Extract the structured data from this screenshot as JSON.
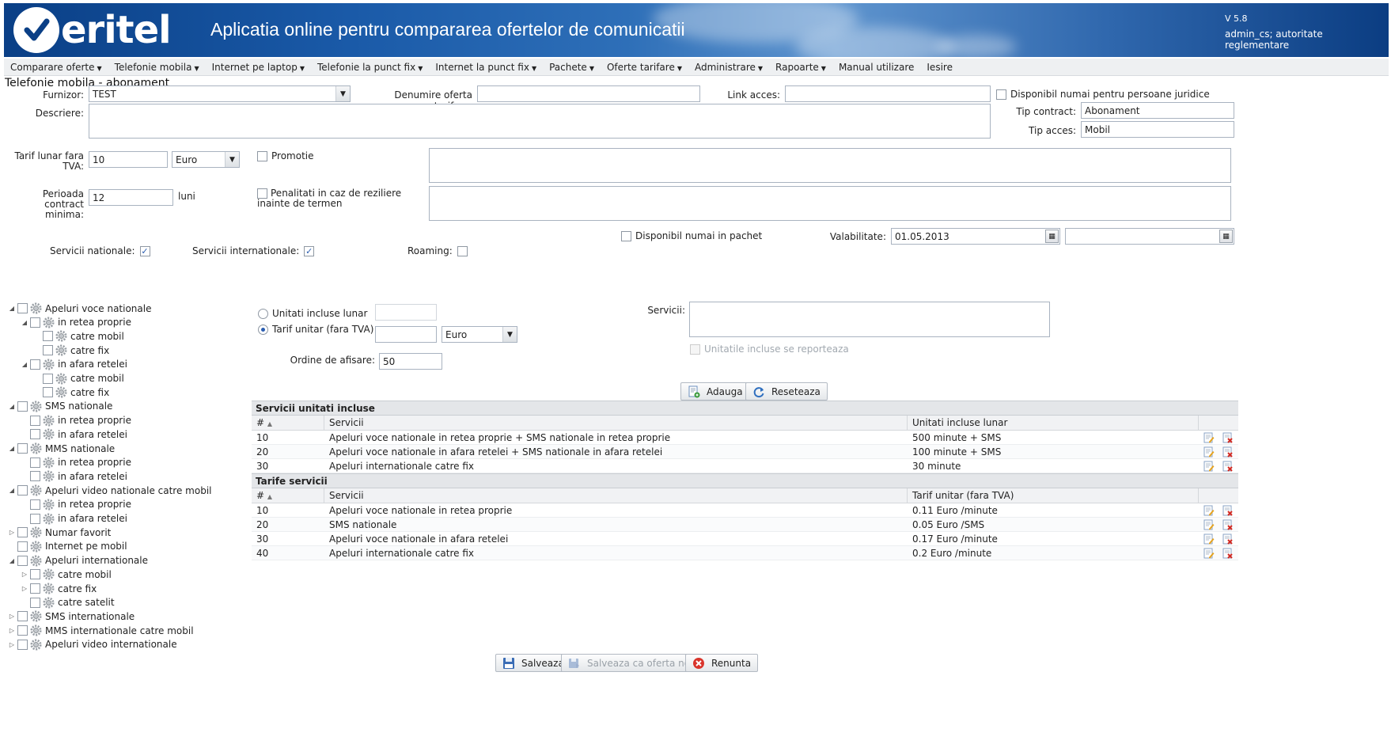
{
  "header": {
    "logo_text": "eritel",
    "app_title": "Aplicatia online pentru compararea ofertelor de comunicatii",
    "version": "V 5.8",
    "user_info": "admin_cs; autoritate reglementare"
  },
  "menu": [
    {
      "label": "Comparare oferte",
      "dropdown": true
    },
    {
      "label": "Telefonie mobila",
      "dropdown": true
    },
    {
      "label": "Internet pe laptop",
      "dropdown": true
    },
    {
      "label": "Telefonie la punct fix",
      "dropdown": true
    },
    {
      "label": "Internet la punct fix",
      "dropdown": true
    },
    {
      "label": "Pachete",
      "dropdown": true
    },
    {
      "label": "Oferte tarifare",
      "dropdown": true
    },
    {
      "label": "Administrare",
      "dropdown": true
    },
    {
      "label": "Rapoarte",
      "dropdown": true
    },
    {
      "label": "Manual utilizare",
      "dropdown": false
    },
    {
      "label": "Iesire",
      "dropdown": false
    }
  ],
  "page_title": "Telefonie mobila - abonament",
  "form": {
    "furnizor_label": "Furnizor:",
    "furnizor_value": "TEST",
    "denumire_label": "Denumire oferta tarifara:",
    "denumire_value": "",
    "link_label": "Link acces:",
    "link_value": "",
    "juridice_label": "Disponibil numai pentru persoane juridice",
    "descriere_label": "Descriere:",
    "tip_contract_label": "Tip contract:",
    "tip_contract_value": "Abonament",
    "tip_acces_label": "Tip acces:",
    "tip_acces_value": "Mobil",
    "tarif_label": "Tarif lunar fara TVA:",
    "tarif_value": "10",
    "moneda_value": "Euro",
    "promotie_label": "Promotie",
    "perioada_label": "Perioada contract minima:",
    "perioada_value": "12",
    "luni_label": "luni",
    "penalitati_label": "Penalitati in caz de reziliere inainte de termen",
    "pachet_label": "Disponibil numai in pachet",
    "valabilitate_label": "Valabilitate:",
    "valabilitate_from": "01.05.2013",
    "valabilitate_to": "",
    "serv_nat_label": "Servicii nationale:",
    "serv_nat_checked": true,
    "serv_int_label": "Servicii internationale:",
    "serv_int_checked": true,
    "roaming_label": "Roaming:",
    "roaming_checked": false
  },
  "tree": [
    {
      "label": "Apeluri voce nationale",
      "level": 0,
      "toggle": "open"
    },
    {
      "label": "in retea proprie",
      "level": 1,
      "toggle": "open"
    },
    {
      "label": "catre mobil",
      "level": 2,
      "toggle": "none"
    },
    {
      "label": "catre fix",
      "level": 2,
      "toggle": "none"
    },
    {
      "label": "in afara retelei",
      "level": 1,
      "toggle": "open"
    },
    {
      "label": "catre mobil",
      "level": 2,
      "toggle": "none"
    },
    {
      "label": "catre fix",
      "level": 2,
      "toggle": "none"
    },
    {
      "label": "SMS nationale",
      "level": 0,
      "toggle": "open"
    },
    {
      "label": "in retea proprie",
      "level": 1,
      "toggle": "none"
    },
    {
      "label": "in afara retelei",
      "level": 1,
      "toggle": "none"
    },
    {
      "label": "MMS nationale",
      "level": 0,
      "toggle": "open"
    },
    {
      "label": "in retea proprie",
      "level": 1,
      "toggle": "none"
    },
    {
      "label": "in afara retelei",
      "level": 1,
      "toggle": "none"
    },
    {
      "label": "Apeluri video nationale catre mobil",
      "level": 0,
      "toggle": "open"
    },
    {
      "label": "in retea proprie",
      "level": 1,
      "toggle": "none"
    },
    {
      "label": "in afara retelei",
      "level": 1,
      "toggle": "none"
    },
    {
      "label": "Numar favorit",
      "level": 0,
      "toggle": "closed"
    },
    {
      "label": "Internet pe mobil",
      "level": 0,
      "toggle": "none"
    },
    {
      "label": "Apeluri internationale",
      "level": 0,
      "toggle": "open"
    },
    {
      "label": "catre mobil",
      "level": 1,
      "toggle": "closed"
    },
    {
      "label": "catre fix",
      "level": 1,
      "toggle": "closed"
    },
    {
      "label": "catre satelit",
      "level": 1,
      "toggle": "none"
    },
    {
      "label": "SMS internationale",
      "level": 0,
      "toggle": "closed"
    },
    {
      "label": "MMS internationale catre mobil",
      "level": 0,
      "toggle": "closed"
    },
    {
      "label": "Apeluri video internationale",
      "level": 0,
      "toggle": "closed"
    }
  ],
  "detail": {
    "unitati_label": "Unitati incluse lunar",
    "unitati_value": "",
    "tarif_unitar_label": "Tarif unitar (fara TVA)",
    "tarif_unitar_value": "",
    "tarif_unitar_currency": "Euro",
    "ordine_label": "Ordine de afisare:",
    "ordine_value": "50",
    "servicii_label": "Servicii:",
    "reporteaza_label": "Unitatile incluse se reporteaza",
    "adauga_label": "Adauga",
    "reseteaza_label": "Reseteaza"
  },
  "grid_unitati": {
    "title": "Servicii unitati incluse",
    "columns": [
      "#",
      "Servicii",
      "Unitati incluse lunar"
    ],
    "rows": [
      {
        "nr": "10",
        "serviciu": "Apeluri voce nationale in retea proprie + SMS nationale in retea proprie",
        "valoare": "500 minute + SMS"
      },
      {
        "nr": "20",
        "serviciu": "Apeluri voce nationale in afara retelei + SMS nationale in afara retelei",
        "valoare": "100 minute + SMS"
      },
      {
        "nr": "30",
        "serviciu": "Apeluri internationale catre fix",
        "valoare": "30 minute"
      }
    ]
  },
  "grid_tarife": {
    "title": "Tarife servicii",
    "columns": [
      "#",
      "Servicii",
      "Tarif unitar (fara TVA)"
    ],
    "rows": [
      {
        "nr": "10",
        "serviciu": "Apeluri voce nationale in retea proprie",
        "valoare": "0.11 Euro /minute"
      },
      {
        "nr": "20",
        "serviciu": "SMS nationale",
        "valoare": "0.05 Euro /SMS"
      },
      {
        "nr": "30",
        "serviciu": "Apeluri voce nationale in afara retelei",
        "valoare": "0.17 Euro /minute"
      },
      {
        "nr": "40",
        "serviciu": "Apeluri internationale catre fix",
        "valoare": "0.2 Euro /minute"
      }
    ]
  },
  "footer": {
    "salveaza_label": "Salveaza",
    "salveaza_noua_label": "Salveaza ca oferta noua",
    "renunta_label": "Renunta"
  },
  "colors": {
    "header_blue": "#0a3f86",
    "accent": "#2a5db0",
    "grid_title_bg": "#e4e6e9"
  }
}
